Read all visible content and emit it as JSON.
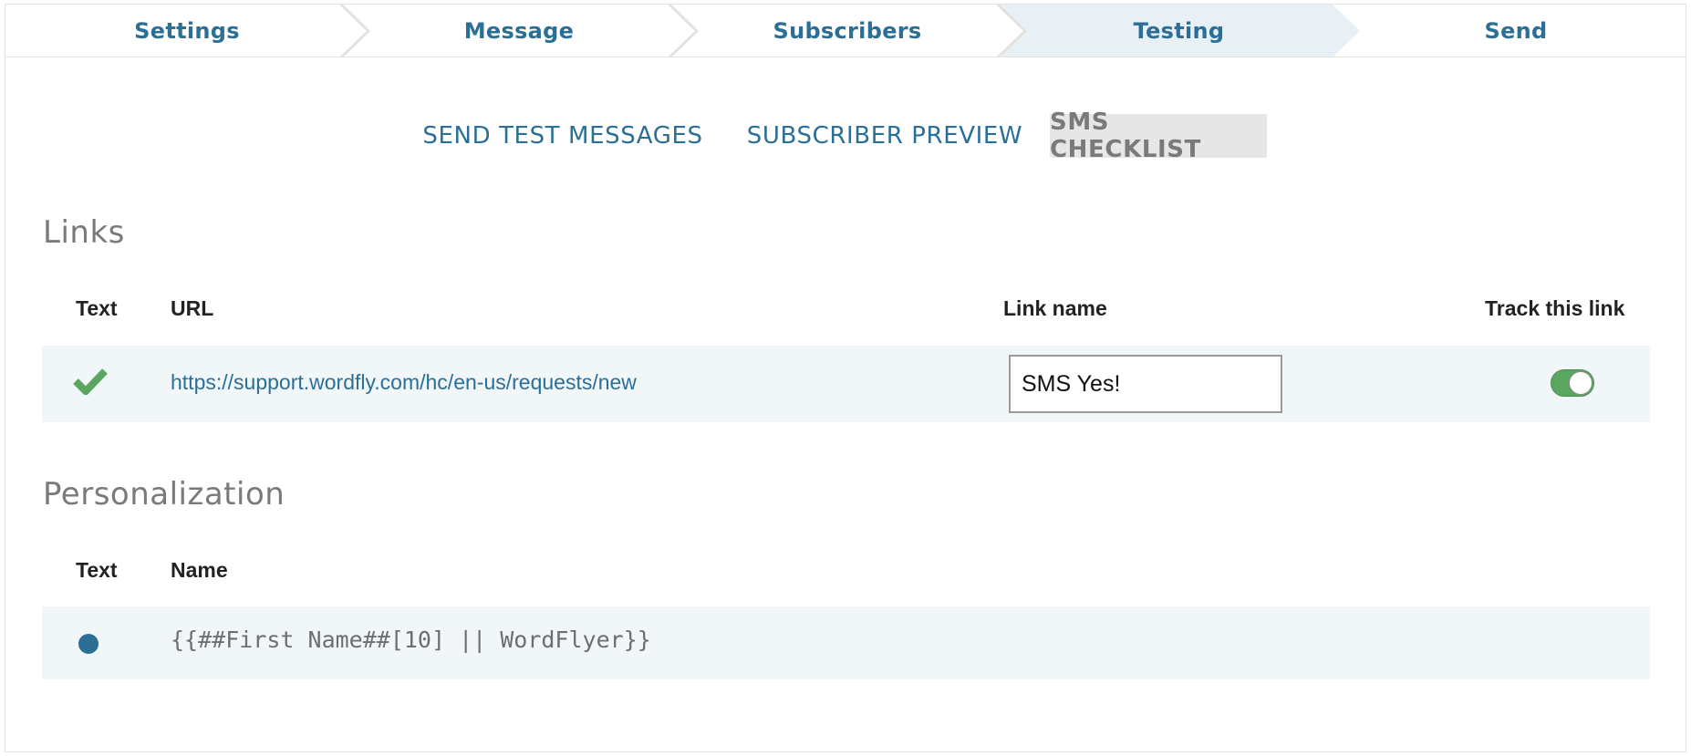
{
  "steps": [
    {
      "label": "Settings",
      "active": false
    },
    {
      "label": "Message",
      "active": false
    },
    {
      "label": "Subscribers",
      "active": false
    },
    {
      "label": "Testing",
      "active": true
    },
    {
      "label": "Send",
      "active": false
    }
  ],
  "subtabs": [
    {
      "label": "SEND TEST MESSAGES",
      "active": false
    },
    {
      "label": "SUBSCRIBER PREVIEW",
      "active": false
    },
    {
      "label": "SMS CHECKLIST",
      "active": true
    }
  ],
  "links": {
    "title": "Links",
    "columns": {
      "text": "Text",
      "url": "URL",
      "link_name": "Link name",
      "track": "Track this link"
    },
    "rows": [
      {
        "status_icon": "check-icon",
        "url": "https://support.wordfly.com/hc/en-us/requests/new",
        "link_name": "SMS Yes!",
        "tracked": true
      }
    ]
  },
  "personalization": {
    "title": "Personalization",
    "columns": {
      "text": "Text",
      "name": "Name"
    },
    "rows": [
      {
        "status_icon": "dot-icon",
        "name": "{{##First Name##[10] || WordFlyer}}"
      }
    ]
  },
  "colors": {
    "accent": "#2b6f96",
    "success": "#5aa661",
    "active_step_bg": "#e8f0f6",
    "row_bg": "#f1f6f9"
  }
}
